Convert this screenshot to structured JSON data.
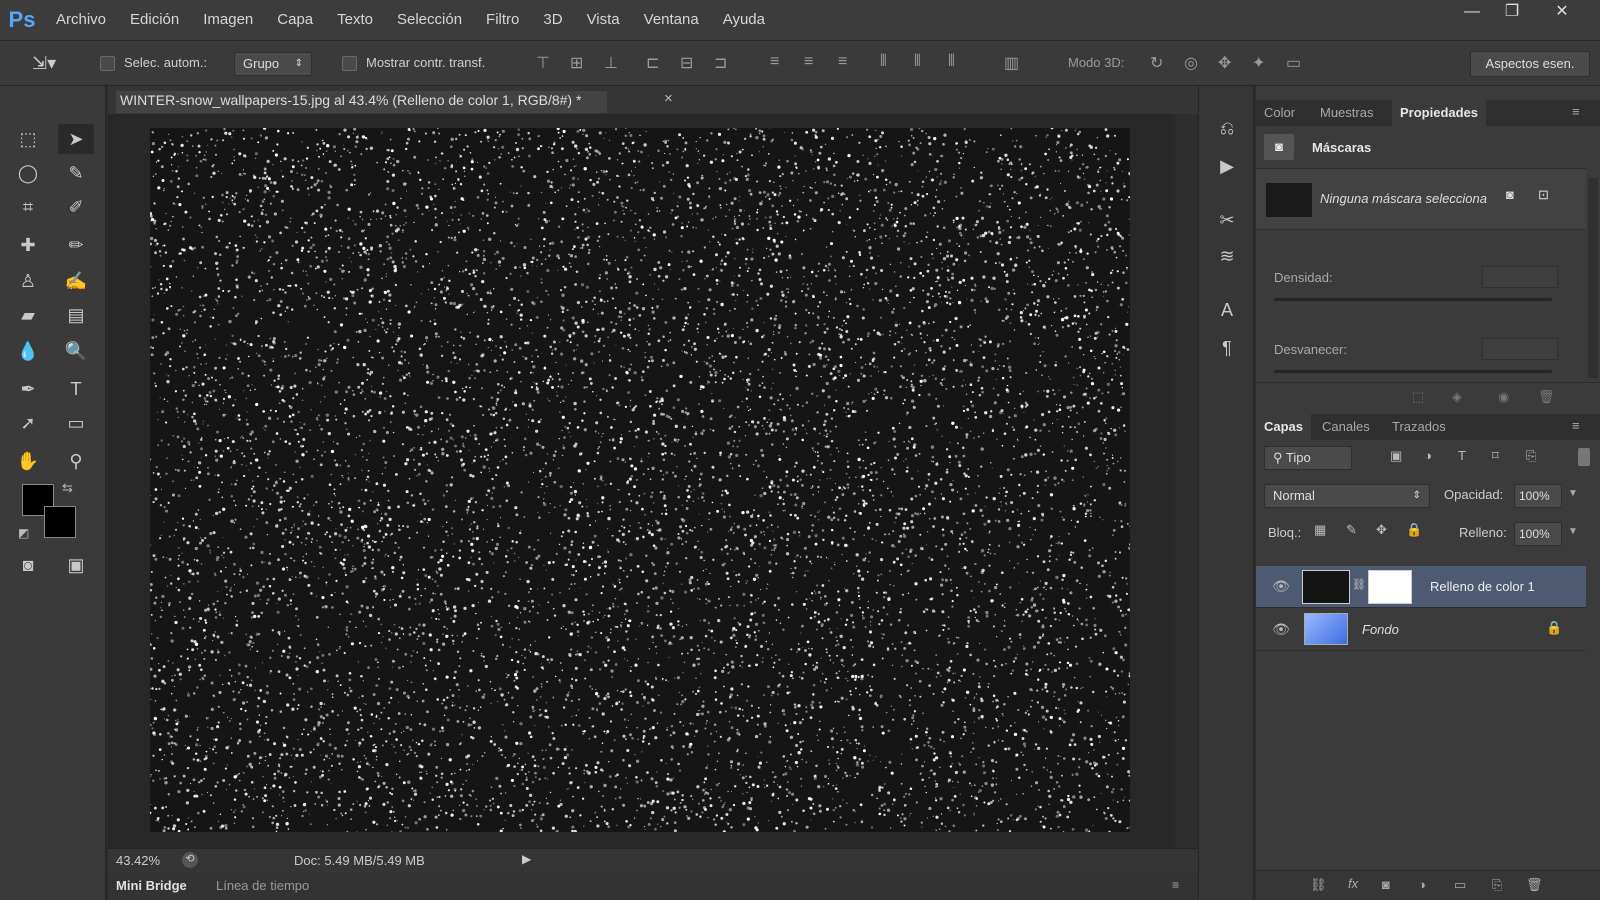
{
  "app": {
    "logo": "Ps"
  },
  "menu": [
    "Archivo",
    "Edición",
    "Imagen",
    "Capa",
    "Texto",
    "Selección",
    "Filtro",
    "3D",
    "Vista",
    "Ventana",
    "Ayuda"
  ],
  "window_controls": [
    "—",
    "❐",
    "✕"
  ],
  "options": {
    "auto_select_label": "Selec. autom.:",
    "auto_select_value": "Grupo",
    "show_transform_label": "Mostrar contr. transf.",
    "mode3d_label": "Modo 3D:",
    "workspace_button": "Aspectos esen."
  },
  "document": {
    "tab_title": "WINTER-snow_wallpapers-15.jpg al 43.4% (Relleno de color 1, RGB/8#) *",
    "close": "×"
  },
  "status": {
    "zoom": "43.42%",
    "doc": "Doc: 5.49 MB/5.49 MB"
  },
  "bottom_tabs": [
    "Mini Bridge",
    "Línea de tiempo"
  ],
  "properties_panel": {
    "tabs": [
      "Color",
      "Muestras",
      "Propiedades"
    ],
    "active_tab": "Propiedades",
    "section_title": "Máscaras",
    "mask_text": "Ninguna máscara selecciona",
    "density_label": "Densidad:",
    "feather_label": "Desvanecer:"
  },
  "layers_panel": {
    "tabs": [
      "Capas",
      "Canales",
      "Trazados"
    ],
    "active_tab": "Capas",
    "filter_value": "Tipo",
    "blend_mode": "Normal",
    "opacity_label": "Opacidad:",
    "opacity_value": "100%",
    "lock_label": "Bloq.:",
    "fill_label": "Relleno:",
    "fill_value": "100%",
    "layers": [
      {
        "name": "Relleno de color 1",
        "selected": true
      },
      {
        "name": "Fondo",
        "selected": false,
        "locked": true
      }
    ]
  },
  "colors": {
    "accent": "#5ba6f5",
    "foreground": "#000000",
    "background": "#000000"
  }
}
